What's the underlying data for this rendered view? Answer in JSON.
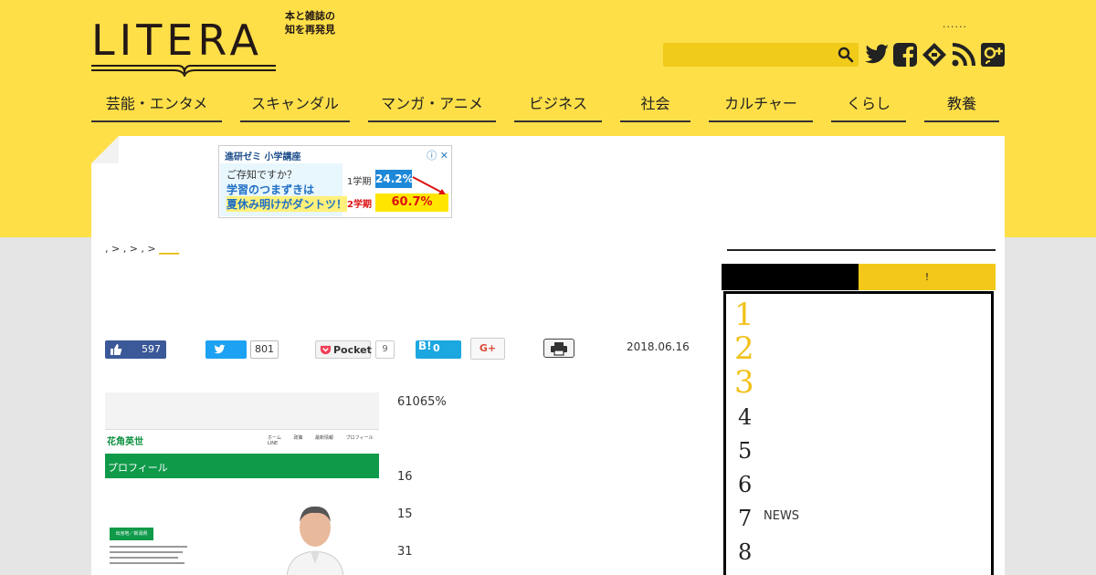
{
  "brand": {
    "logo_word": "LITERA",
    "tagline": [
      "本と雑誌の",
      "知を再発見"
    ]
  },
  "header": {
    "dots": "......",
    "search_placeholder": "",
    "social_icons": [
      "twitter-icon",
      "facebook-icon",
      "feedly-icon",
      "rss-icon",
      "google-plus-icon"
    ]
  },
  "nav": [
    "芸能・エンタメ",
    "スキャンダル",
    "マンガ・アニメ",
    "ビジネス",
    "社会",
    "カルチャー",
    "くらし",
    "教養"
  ],
  "ad": {
    "header": "進研ゼミ 小学講座",
    "line1": "ご存知ですか？",
    "line2": "学習のつまずきは",
    "line3": "夏休み明けがダントツ！",
    "term1": "1学期",
    "term2": "2学期",
    "value1": "24.2%",
    "value2": "60.7%"
  },
  "breadcrumb": {
    "text": ", > , > , >",
    "link": "____"
  },
  "share": {
    "facebook_count": "597",
    "twitter_count": "801",
    "pocket_label": "Pocket",
    "pocket_count": "9",
    "hatena_label": "B!",
    "hatena_count": "0",
    "gplus_label": "G+"
  },
  "article": {
    "date": "2018.06.16",
    "paragraphs": [
      "61065%",
      "16",
      "15",
      "31"
    ],
    "image": {
      "logo": "花角英世",
      "menu": "ホーム 政策 最新情報 プロフィール LINE",
      "band_title": "プロフィール",
      "label": "出身地／新潟県"
    }
  },
  "sidebar": {
    "tab_active": "",
    "tab_other": "!",
    "ranking": [
      {
        "rank": "1",
        "title": ""
      },
      {
        "rank": "2",
        "title": ""
      },
      {
        "rank": "3",
        "title": ""
      },
      {
        "rank": "4",
        "title": ""
      },
      {
        "rank": "5",
        "title": ""
      },
      {
        "rank": "6",
        "title": ""
      },
      {
        "rank": "7",
        "title": "NEWS"
      },
      {
        "rank": "8",
        "title": ""
      }
    ]
  },
  "colors": {
    "brand_yellow": "#fedf48",
    "accent_yellow": "#f4c81a",
    "rank_gold": "#f1c21b",
    "facebook": "#3b5998",
    "twitter": "#1da1f2",
    "hatena": "#1ba7e0"
  }
}
